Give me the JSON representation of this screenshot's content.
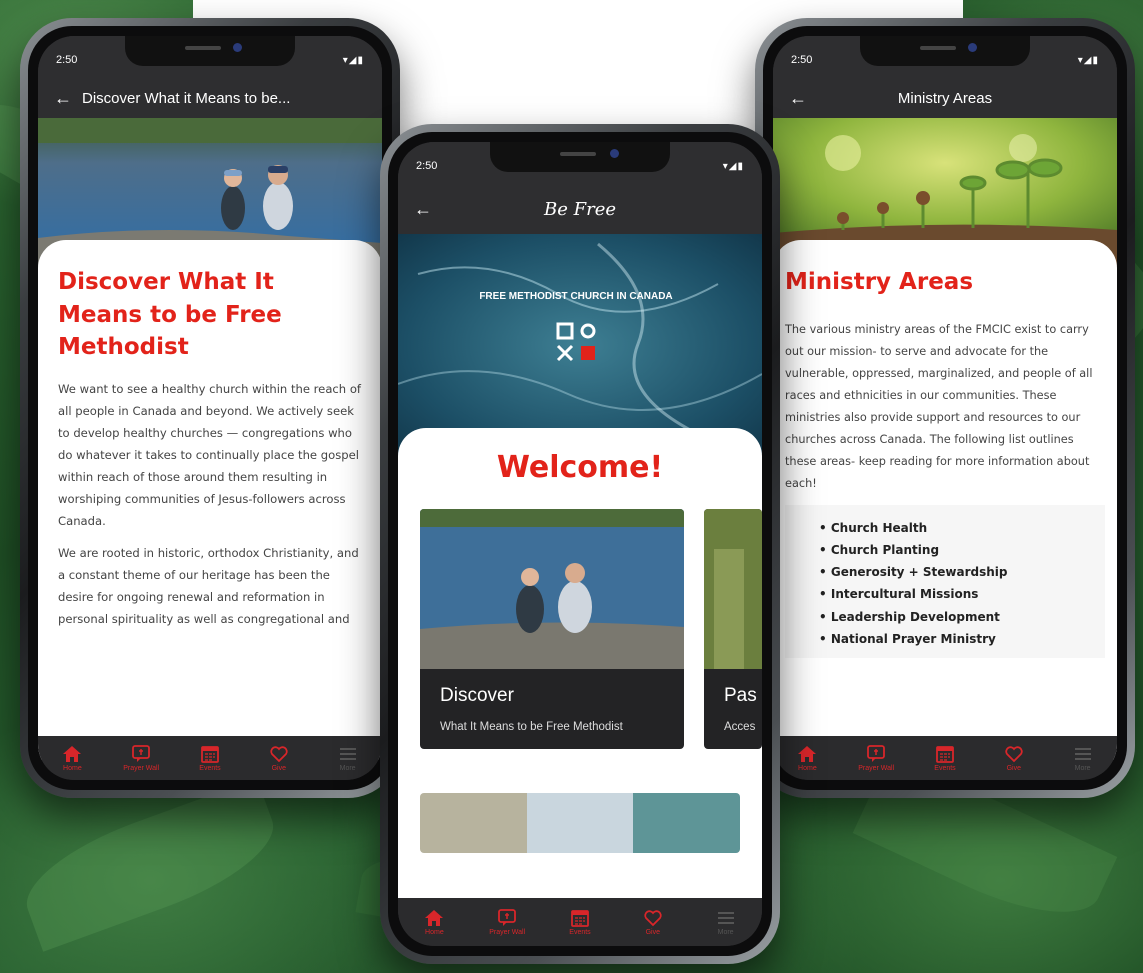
{
  "left_phone": {
    "time": "2:50",
    "status_icons": "▾◢▮",
    "title": "Discover What it Means to be...",
    "heading": "Discover What It Means to be Free Methodist",
    "paragraphs": [
      "We want to see a healthy church within the reach of all people in Canada and beyond. We actively seek to develop healthy churches — congregations who do whatever it takes to continually place the gospel within reach of those around them resulting in worshiping communities of Jesus-followers across Canada.",
      "We are rooted in historic, orthodox Christianity, and a constant theme of our heritage has been the desire for ongoing renewal and reformation in personal spirituality as well as congregational and"
    ]
  },
  "center_phone": {
    "time": "2:50",
    "status_icons": "▾◢▮",
    "title": "Be Free",
    "logo_text": "FREE METHODIST CHURCH IN CANADA",
    "welcome": "Welcome!",
    "slides": [
      {
        "title": "Discover",
        "subtitle": "What It Means to be Free Methodist"
      },
      {
        "title": "Pas",
        "subtitle": "Acces"
      }
    ]
  },
  "right_phone": {
    "time": "2:50",
    "status_icons": "▾◢▮",
    "title": "Ministry Areas",
    "heading": "Ministry Areas",
    "paragraph": "The various ministry areas of the FMCIC exist to carry out our mission- to serve and advocate for the vulnerable, oppressed, marginalized, and people of all races and ethnicities in our communities. These ministries also provide support and resources to our churches across Canada. The following list outlines these areas- keep reading for more information about each!",
    "items": [
      "Church Health",
      "Church Planting",
      "Generosity + Stewardship",
      "Intercultural Missions",
      "Leadership Development",
      "National Prayer Ministry"
    ]
  },
  "tabs": {
    "home": "Home",
    "prayer": "Prayer Wall",
    "events": "Events",
    "give": "Give",
    "more": "More"
  },
  "colors": {
    "accent_red": "#e2231a",
    "bar_dark": "#2e2e30"
  }
}
